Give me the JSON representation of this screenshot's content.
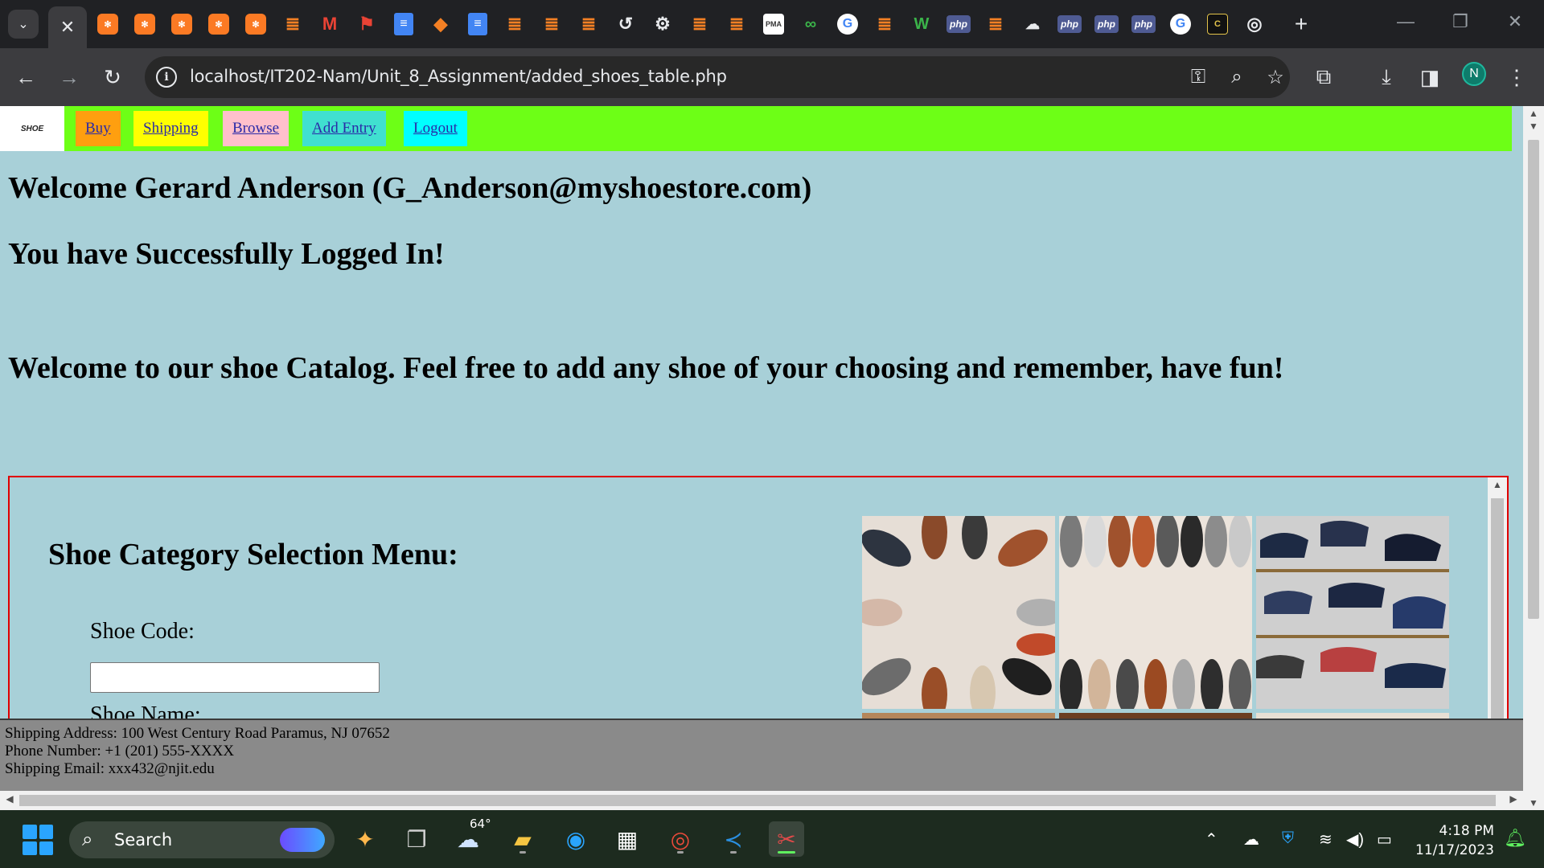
{
  "browser": {
    "active_tab_icon": "close-icon",
    "url": "localhost/IT202-Nam/Unit_8_Assignment/added_shoes_table.php",
    "profile_initial": "N",
    "tab_favicons": [
      "xampp",
      "xampp",
      "xampp",
      "xampp",
      "xampp",
      "stackoverflow",
      "gmail",
      "flag",
      "google-docs",
      "extension",
      "google-docs",
      "stackoverflow",
      "stackoverflow",
      "stackoverflow",
      "history",
      "settings",
      "stackoverflow",
      "stackoverflow",
      "phpmyadmin",
      "infinity",
      "google",
      "stackoverflow",
      "w3schools",
      "php",
      "stackoverflow",
      "mariadb",
      "php",
      "php",
      "php",
      "google",
      "c-logo",
      "chrome"
    ]
  },
  "site": {
    "logo_text": "SHOE",
    "nav": [
      {
        "label": "Buy ",
        "color": "#ff9f0f"
      },
      {
        "label": "Shipping ",
        "color": "#ffff00"
      },
      {
        "label": "Browse ",
        "color": "#ffc0cb"
      },
      {
        "label": "Add Entry ",
        "color": "#40e0d0"
      },
      {
        "label": "Logout",
        "color": "#00ffff"
      }
    ],
    "welcome": "Welcome Gerard Anderson (G_Anderson@myshoestore.com)",
    "login_msg": "You have Successfully Logged In!",
    "catalog_msg": "Welcome to our shoe Catalog. Feel free to add any shoe of your choosing and remember, have fun!",
    "menu_title": "Shoe Category Selection Menu:",
    "shoe_code_label": "Shoe Code:",
    "shoe_code_value": "",
    "shoe_name_label": "Shoe Name:",
    "footer": {
      "address": "Shipping Address: 100 West Century Road Paramus, NJ 07652",
      "phone": "Phone Number: +1 (201) 555-XXXX",
      "email": "Shipping Email: xxx432@njit.edu"
    }
  },
  "taskbar": {
    "search_placeholder": "Search",
    "weather": "64°",
    "time": "4:18 PM",
    "date": "11/17/2023"
  },
  "colors": {
    "page_bg": "#a8d0d8",
    "nav_bg": "#6dff16",
    "iframe_border": "#e00000",
    "footer_bg": "#8a8a8a"
  }
}
